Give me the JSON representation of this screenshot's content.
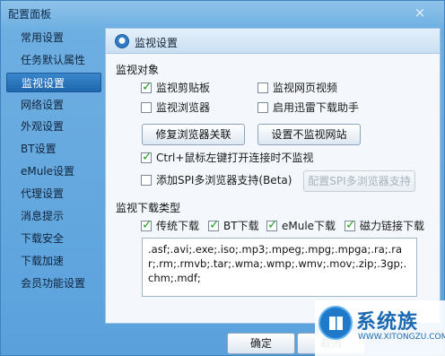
{
  "window": {
    "title": "配置面板",
    "close_icon": "×"
  },
  "sidebar": {
    "items": [
      {
        "label": "常用设置"
      },
      {
        "label": "任务默认属性"
      },
      {
        "label": "监视设置"
      },
      {
        "label": "网络设置"
      },
      {
        "label": "外观设置"
      },
      {
        "label": "BT设置"
      },
      {
        "label": "eMule设置"
      },
      {
        "label": "代理设置"
      },
      {
        "label": "消息提示"
      },
      {
        "label": "下载安全"
      },
      {
        "label": "下载加速"
      },
      {
        "label": "会员功能设置"
      }
    ],
    "active_index": 2
  },
  "panel": {
    "title": "监视设置",
    "monitor_objects": {
      "label": "监视对象",
      "options": [
        {
          "label": "监视剪贴板",
          "checked": true
        },
        {
          "label": "监视网页视频",
          "checked": false
        },
        {
          "label": "监视浏览器",
          "checked": false
        },
        {
          "label": "启用迅雷下载助手",
          "checked": false
        }
      ],
      "repair_button": "修复浏览器关联",
      "no_monitor_button": "设置不监视网站",
      "ctrl_option": {
        "label": "Ctrl+鼠标左键打开连接时不监视",
        "checked": true
      },
      "spi_option": {
        "label": "添加SPI多浏览器支持(Beta)",
        "checked": false
      },
      "spi_button": "配置SPI多浏览器支持"
    },
    "download_types": {
      "label": "监视下载类型",
      "options": [
        {
          "label": "传统下载",
          "checked": true
        },
        {
          "label": "BT下载",
          "checked": true
        },
        {
          "label": "eMule下载",
          "checked": true
        },
        {
          "label": "磁力链接下载",
          "checked": true
        }
      ],
      "extensions": ".asf;.avi;.exe;.iso;.mp3;.mpeg;.mpg;.mpga;.ra;.rar;.rm;.rmvb;.tar;.wma;.wmp;.wmv;.mov;.zip;.3gp;.chm;.mdf;"
    }
  },
  "footer": {
    "ok": "确定",
    "cancel": "取消"
  },
  "watermark": {
    "brand": "系统族",
    "url": "WWW.XITONGZU.COM"
  },
  "colors": {
    "accent": "#1f66ad",
    "check": "#2a9d2a"
  }
}
